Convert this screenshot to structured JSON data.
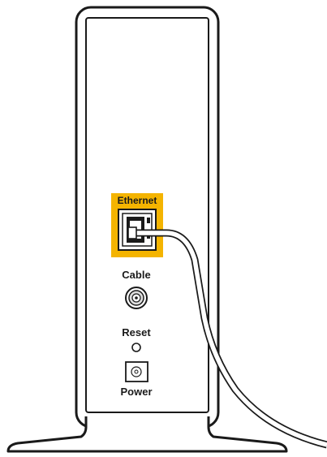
{
  "labels": {
    "ethernet": "Ethernet",
    "cable": "Cable",
    "reset": "Reset",
    "power": "Power"
  },
  "colors": {
    "ethernet_highlight": "#f4b400",
    "outline": "#1a1a1a",
    "background": "#ffffff"
  }
}
